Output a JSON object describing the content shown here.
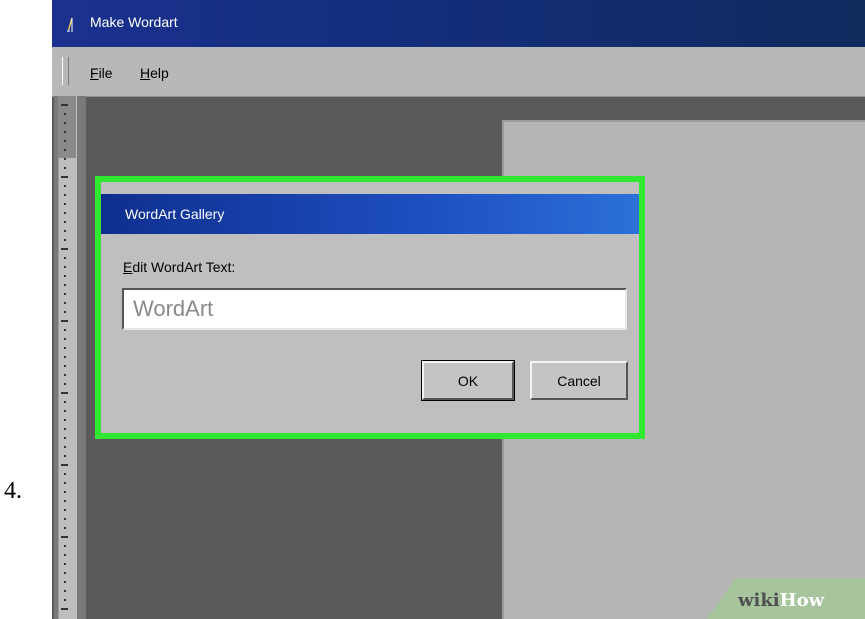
{
  "step": {
    "number": "4."
  },
  "window": {
    "title": "Make Wordart",
    "icon": "wordart-app-icon"
  },
  "menu": {
    "items": [
      {
        "label": "File"
      },
      {
        "label": "Help"
      }
    ]
  },
  "dialog": {
    "title": "WordArt Gallery",
    "field_label": "Edit WordArt Text:",
    "input_value": "WordArt",
    "ok_label": "OK",
    "cancel_label": "Cancel",
    "highlight_color": "#31e831"
  },
  "watermark": {
    "wiki": "wiki",
    "how": "How"
  },
  "colors": {
    "title_bar": "#142f7e",
    "dialog_title_bar": "#1d4fc0",
    "workspace": "#5a5a5a",
    "page": "#b5b5b5"
  }
}
